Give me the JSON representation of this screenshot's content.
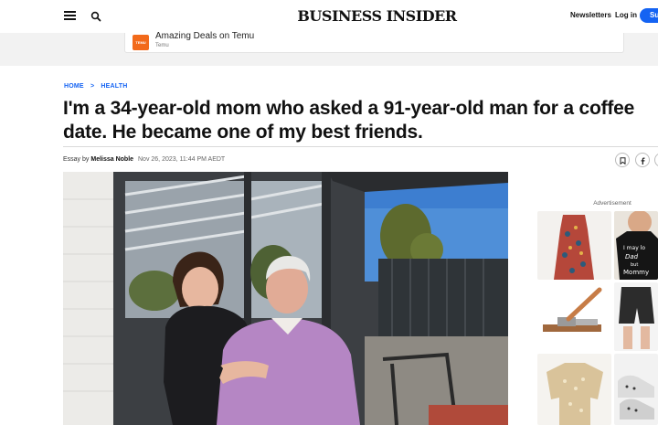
{
  "header": {
    "logo": "BUSINESS INSIDER",
    "newsletters": "Newsletters",
    "login": "Log in",
    "subscribe": "Su"
  },
  "top_ad": {
    "logo_text": "SHOP LIKE A BILLIONAIRE TEMU",
    "title": "Amazing Deals on Temu",
    "sponsor": "Temu"
  },
  "breadcrumb": {
    "home": "HOME",
    "separator": ">",
    "section": "HEALTH"
  },
  "article": {
    "headline": "I'm a 34-year-old mom who asked a 91-year-old man for a coffee date. He became one of my best friends.",
    "byline_prefix": "Essay by",
    "author": "Melissa Noble",
    "date": "Nov 26, 2023, 11:44 PM AEDT"
  },
  "sidebar": {
    "ad_label": "Advertisement",
    "shirt_text": "I may look Daddy's but Mommy's"
  },
  "colors": {
    "accent": "#1463f3",
    "temu": "#f26a1b"
  }
}
